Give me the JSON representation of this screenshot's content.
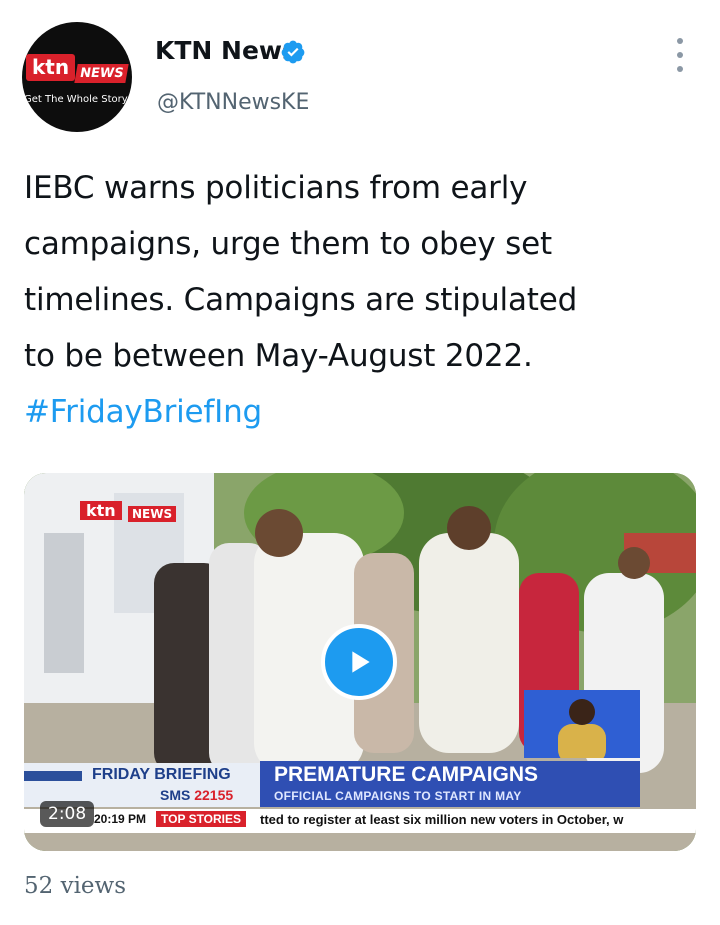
{
  "author": {
    "display_name": "KTN News",
    "handle": "@KTNNewsKE",
    "avatar": {
      "logo_ktn": "ktn",
      "logo_news": "NEWS",
      "tagline": "Get The Whole Story"
    },
    "verified_icon": "verified-badge-icon"
  },
  "tweet": {
    "lines": [
      "IEBC warns politicians from early",
      "campaigns, urge them to obey set",
      "timelines. Campaigns are stipulated",
      "to be between May-August 2022."
    ],
    "hashtag": "#FridayBriefIng"
  },
  "media": {
    "duration": "2:08",
    "play_icon": "play-icon",
    "channel_logo_ktn": "ktn",
    "channel_logo_news": "NEWS",
    "lower_third": {
      "show": "FRIDAY BRIEFING",
      "sms_label": "SMS",
      "sms_number": "22155",
      "headline": "PREMATURE CAMPAIGNS",
      "subheadline": "OFFICIAL CAMPAIGNS TO START IN MAY"
    },
    "ticker": {
      "time": "20:19 PM",
      "label": "TOP STORIES",
      "text": "tted to register at least six million new voters in October, w"
    }
  },
  "stats": {
    "views": "52 views"
  },
  "colors": {
    "accent": "#1d9bf0",
    "text": "#0f1419",
    "muted": "#536471",
    "brand_red": "#d9212b"
  }
}
